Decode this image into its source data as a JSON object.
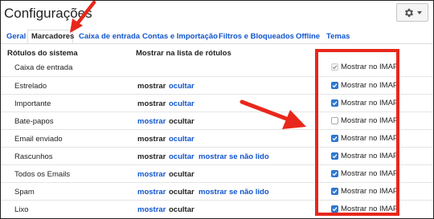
{
  "page": {
    "title": "Configurações"
  },
  "tabs": [
    {
      "label": "Geral",
      "active": false
    },
    {
      "label": "Marcadores",
      "active": true
    },
    {
      "label": "Caixa de entrada",
      "active": false
    },
    {
      "label": "Contas e Importação",
      "active": false
    },
    {
      "label": "Filtros e Bloqueados",
      "active": false
    },
    {
      "label": "Offline",
      "active": false
    },
    {
      "label": "Temas",
      "active": false
    }
  ],
  "headers": {
    "system_labels": "Rótulos do sistema",
    "show_in_list": "Mostrar na lista de rótulos"
  },
  "imap_label": "Mostrar no IMAP",
  "rows": [
    {
      "label": "Caixa de entrada",
      "imap": "disabled"
    },
    {
      "label": "Estrelado",
      "show": "mostrar",
      "hide": "ocultar",
      "imap": "checked"
    },
    {
      "label": "Importante",
      "show": "mostrar",
      "hide": "ocultar",
      "imap": "checked"
    },
    {
      "label": "Bate-papos",
      "show": "mostrar",
      "hide": "ocultar",
      "imap": "unchecked"
    },
    {
      "label": "Email enviado",
      "show": "mostrar",
      "hide": "ocultar",
      "imap": "checked"
    },
    {
      "label": "Rascunhos",
      "show": "mostrar",
      "hide": "ocultar",
      "unread": "mostrar se não lido",
      "imap": "checked"
    },
    {
      "label": "Todos os Emails",
      "show": "mostrar",
      "hide": "ocultar",
      "imap": "checked"
    },
    {
      "label": "Spam",
      "show": "mostrar",
      "hide": "ocultar",
      "unread": "mostrar se não lido",
      "imap": "checked"
    },
    {
      "label": "Lixo",
      "show": "mostrar",
      "hide": "ocultar",
      "imap": "checked"
    }
  ],
  "icons": {
    "settings": "gear-icon",
    "dropdown": "chevron-down-icon",
    "checkbox": "checkmark-icon",
    "annotation": "red-arrow-icon"
  },
  "colors": {
    "link": "#1155cc",
    "checkbox": "#2f7bd6",
    "annotation": "#e8271c"
  }
}
